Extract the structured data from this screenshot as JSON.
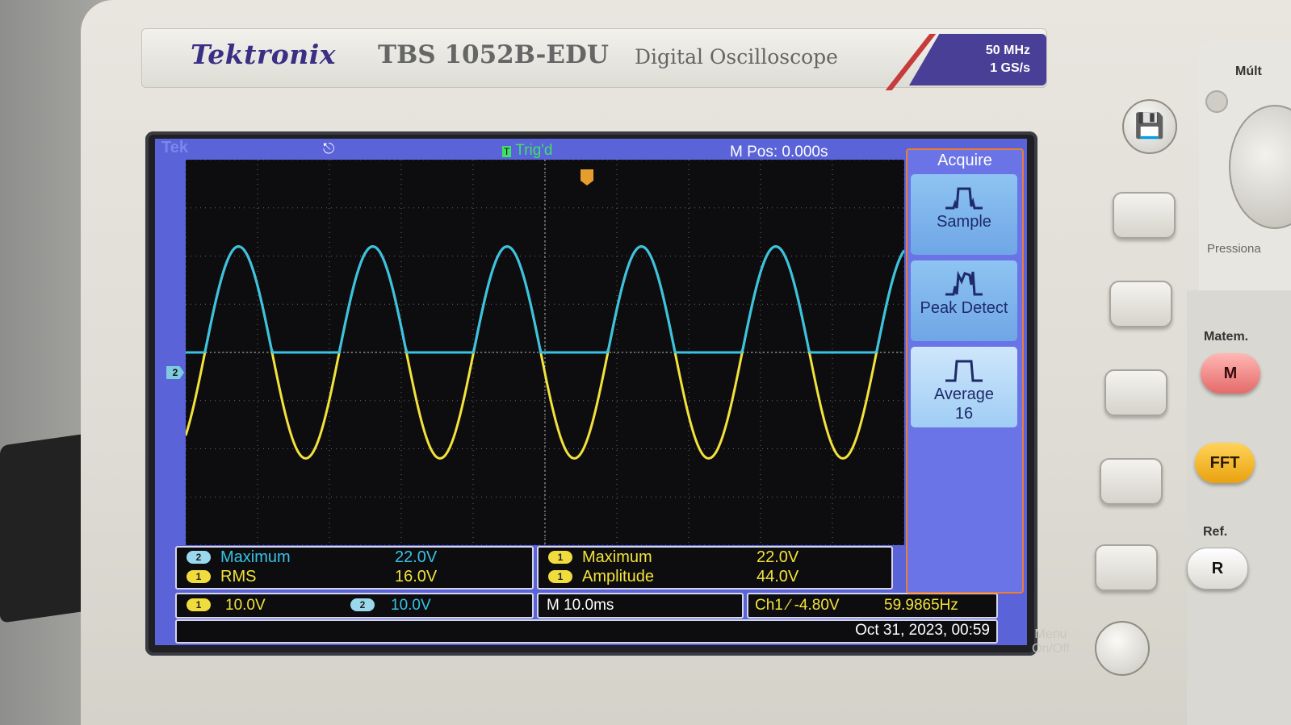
{
  "device": {
    "brand": "Tektronix",
    "model": "TBS 1052B-EDU",
    "subtitle": "Digital Oscilloscope",
    "spec_bandwidth": "50 MHz",
    "spec_sample_rate": "1 GS/s"
  },
  "screen": {
    "tek_mark": "Tek",
    "trigger_status": "Trig'd",
    "trigger_status_icon": "T",
    "m_pos": "M Pos: 0.000s",
    "ch2_marker": "2",
    "colors": {
      "ch1": "#f3e23c",
      "ch2": "#37c3e6",
      "menu_border": "#ef7c32"
    }
  },
  "measurements": {
    "left": [
      {
        "badge": "2",
        "name": "Maximum",
        "value": "22.0V",
        "channel": "ch2"
      },
      {
        "badge": "1",
        "name": "RMS",
        "value": "16.0V",
        "channel": "ch1"
      }
    ],
    "right": [
      {
        "badge": "1",
        "name": "Maximum",
        "value": "22.0V",
        "channel": "ch1"
      },
      {
        "badge": "1",
        "name": "Amplitude",
        "value": "44.0V",
        "channel": "ch1"
      }
    ]
  },
  "status": {
    "ch1_badge": "1",
    "ch1_scale": "10.0V",
    "ch2_badge": "2",
    "ch2_scale": "10.0V",
    "timebase": "M 10.0ms",
    "trigger": "Ch1 ∕ -4.80V",
    "frequency": "59.9865Hz",
    "datetime": "Oct 31, 2023, 00:59"
  },
  "acquire_menu": {
    "title": "Acquire",
    "items": [
      {
        "label": "Sample",
        "icon": "sample-icon"
      },
      {
        "label": "Peak Detect",
        "icon": "peak-detect-icon"
      },
      {
        "label": "Average",
        "sub": "16",
        "icon": "average-icon",
        "selected": true
      }
    ]
  },
  "panel": {
    "menu_onoff_1": "Menu",
    "menu_onoff_2": "On/Off",
    "multi_label": "Múlt",
    "press_hint": "Pressiona",
    "math_label": "Matem.",
    "math_button": "M",
    "fft_button": "FFT",
    "ref_label": "Ref.",
    "ref_button": "R",
    "save_icon": "save-icon"
  },
  "waveform": {
    "cycles_visible": 5.35,
    "ch1_peak_div": 2.2,
    "ch2_peak_div": 2.2
  }
}
